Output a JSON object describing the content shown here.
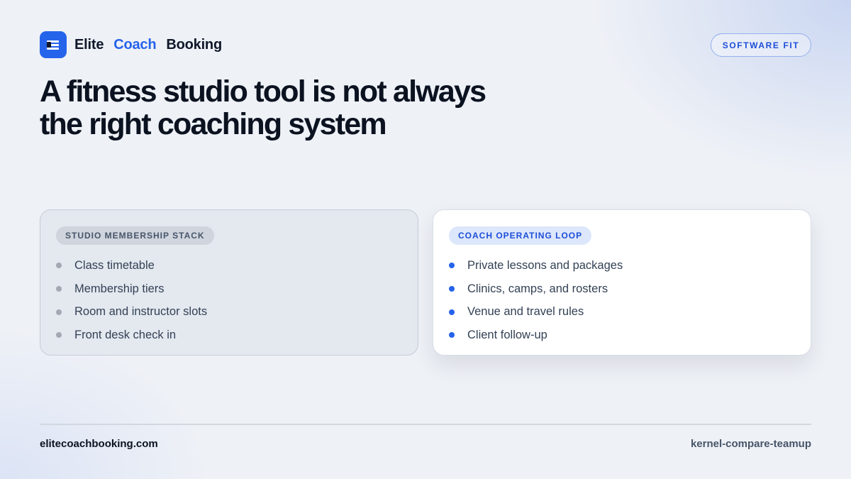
{
  "brand": {
    "word1": "Elite",
    "word2": "Coach",
    "word3": "Booking",
    "logo_icon": "list-icon",
    "accent_color": "#2563eb"
  },
  "badge": "SOFTWARE FIT",
  "headline": {
    "line1": "A fitness studio tool is not always",
    "line2": "the right coaching system"
  },
  "cards": [
    {
      "tag": "STUDIO MEMBERSHIP STACK",
      "items": [
        "Class timetable",
        "Membership tiers",
        "Room and instructor slots",
        "Front desk check in"
      ]
    },
    {
      "tag": "COACH OPERATING LOOP",
      "items": [
        "Private lessons and packages",
        "Clinics, camps, and rosters",
        "Venue and travel rules",
        "Client follow-up"
      ]
    }
  ],
  "footer": {
    "site": "elitecoachbooking.com",
    "slug": "kernel-compare-teamup"
  }
}
